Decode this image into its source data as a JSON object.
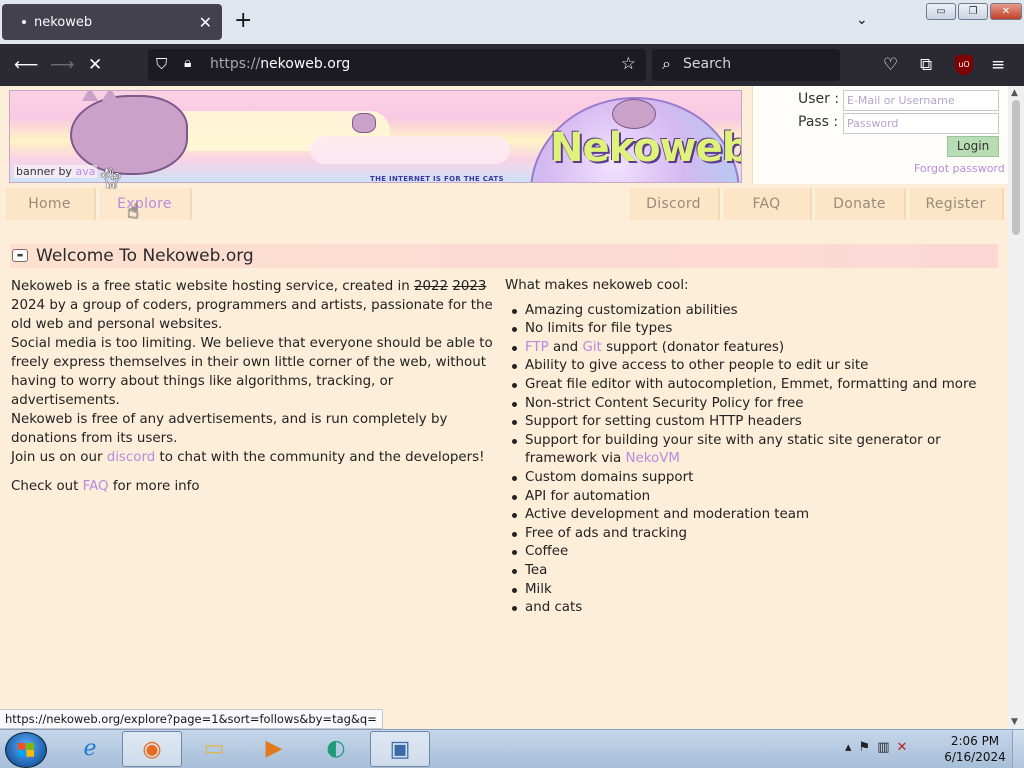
{
  "browser": {
    "tab_title": "nekoweb",
    "tab_close": "✕",
    "new_tab": "+",
    "tab_list": "⌄",
    "url_scheme": "https://",
    "url_host": "nekoweb.org",
    "search_placeholder": "Search",
    "window_min": "▭",
    "window_max": "❐",
    "window_close": "✕",
    "ublock_label": "uO"
  },
  "banner": {
    "logo_text": "Nekoweb",
    "credit_prefix": "banner by",
    "credit_author": "ava",
    "tagline": "THE INTERNET IS FOR THE CATS"
  },
  "login": {
    "user_label": "User :",
    "pass_label": "Pass :",
    "user_placeholder": "E-Mail or Username",
    "pass_placeholder": "Password",
    "login_button": "Login",
    "forgot_password": "Forgot password"
  },
  "menu": {
    "home": "Home",
    "explore": "Explore",
    "discord": "Discord",
    "faq": "FAQ",
    "donate": "Donate",
    "register": "Register"
  },
  "welcome": {
    "title": "Welcome To Nekoweb.org"
  },
  "intro": {
    "p1_start": "Nekoweb is a free static website hosting service, created in ",
    "year_struck_1": "2022",
    "year_struck_2": "2023",
    "p1_end": "2024 by a group of coders, programmers and artists, passionate for the old web and personal websites.",
    "p2": "Social media is too limiting. We believe that everyone should be able to freely express themselves in their own little corner of the web, without having to worry about things like algorithms, tracking, or advertisements.",
    "p3": "Nekoweb is free of any advertisements, and is run completely by donations from its users.",
    "p4_start": "Join us on our ",
    "p4_link": "discord",
    "p4_end": " to chat with the community and the developers!",
    "p5_start": "Check out ",
    "p5_link": "FAQ",
    "p5_end": " for more info"
  },
  "features": {
    "heading": "What makes nekoweb cool:",
    "item1": "Amazing customization abilities",
    "item2": "No limits for file types",
    "item3_link1": "FTP",
    "item3_mid": " and ",
    "item3_link2": "Git",
    "item3_end": " support (donator features)",
    "item4": "Ability to give access to other people to edit ur site",
    "item5": "Great file editor with autocompletion, Emmet, formatting and more",
    "item6": "Non-strict Content Security Policy for free",
    "item7": "Support for setting custom HTTP headers",
    "item8_start": "Support for building your site with any static site generator or framework via ",
    "item8_link": "NekoVM",
    "item9": "Custom domains support",
    "item10": "API for automation",
    "item11": "Active development and moderation team",
    "item12": "Free of ads and tracking",
    "item13": "Coffee",
    "item14": "Tea",
    "item15": "Milk",
    "item16": "and cats"
  },
  "status_bar": {
    "hover_url": "https://nekoweb.org/explore?page=1&sort=follows&by=tag&q="
  },
  "taskbar": {
    "time": "2:06 PM",
    "date": "6/16/2024"
  },
  "colors": {
    "page_bg": "#fdeed9",
    "link": "#b98be0",
    "menu_text": "#9a8a7a",
    "login_button": "#b8ddb5"
  }
}
